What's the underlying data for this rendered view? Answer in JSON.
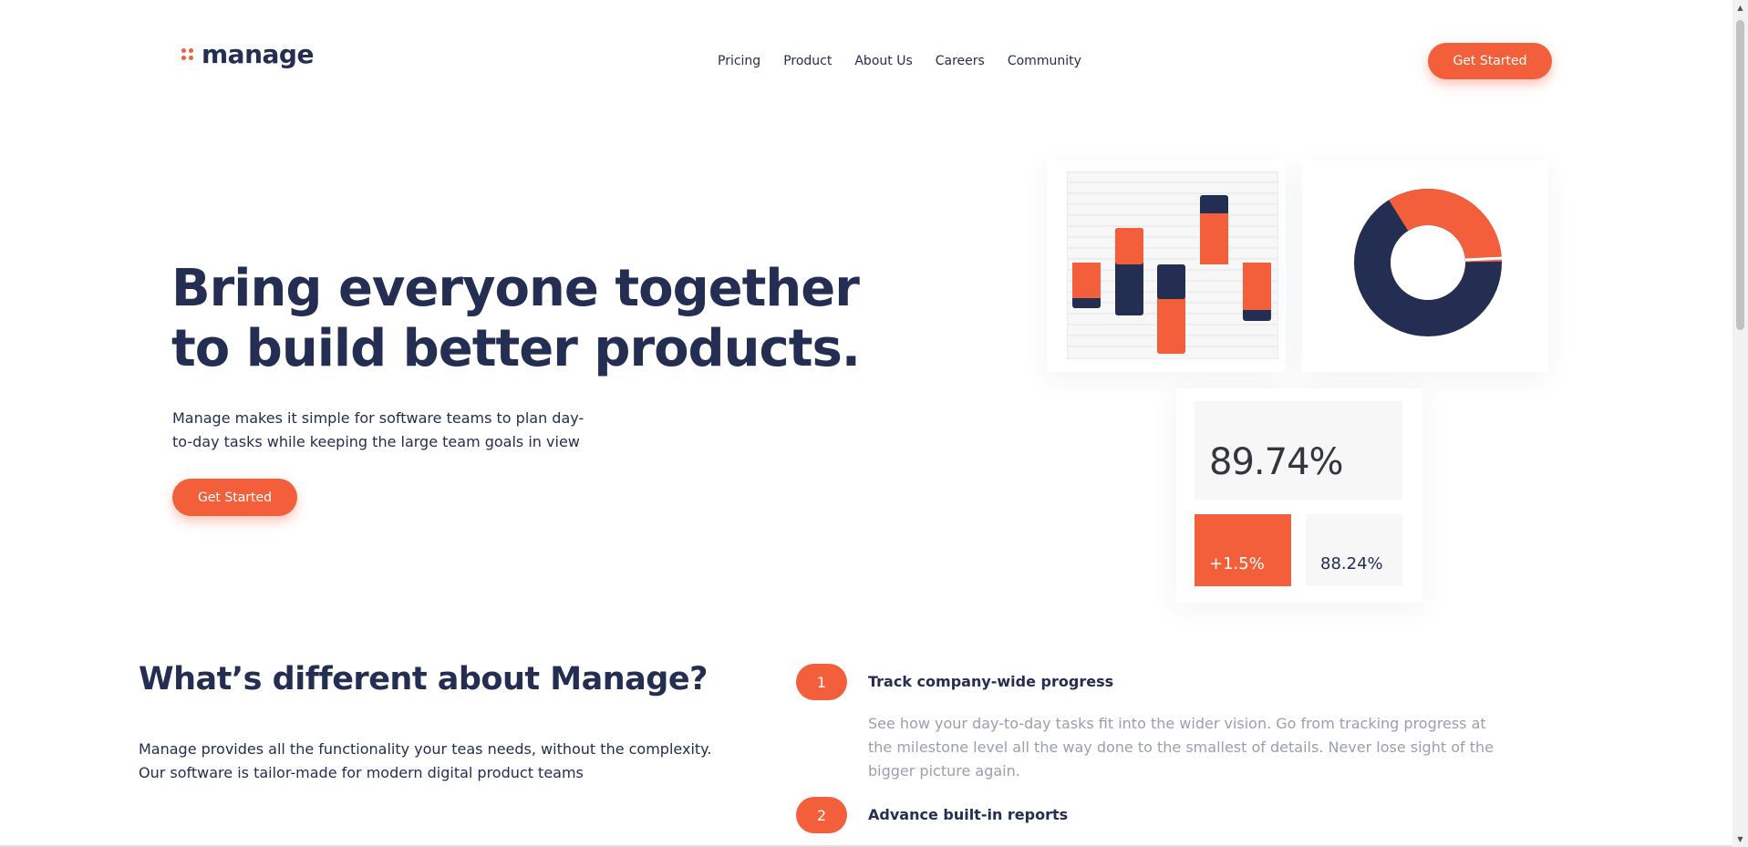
{
  "brand": {
    "name": "manage",
    "accent_color": "#f25f3a",
    "dark_color": "#242d52"
  },
  "nav": {
    "items": [
      {
        "label": "Pricing"
      },
      {
        "label": "Product"
      },
      {
        "label": "About Us"
      },
      {
        "label": "Careers"
      },
      {
        "label": "Community"
      }
    ]
  },
  "header": {
    "cta_label": "Get Started"
  },
  "hero": {
    "title": "Bring everyone together to build better products.",
    "description": "Manage makes it simple for software teams to plan day-to-day tasks while keeping the large team goals in view",
    "cta_label": "Get Started"
  },
  "dashboard": {
    "main_stat": "89.74%",
    "change_stat": "+1.5%",
    "secondary_stat": "88.24%"
  },
  "different": {
    "title": "What’s different about Manage?",
    "description": "Manage provides all the functionality your teas needs, without the complexity. Our software is tailor-made for modern digital product teams",
    "features": [
      {
        "number": "1",
        "title": "Track company-wide progress",
        "description": "See how your day-to-day tasks fit into the wider vision. Go from tracking progress at the milestone level all the way done to the smallest of details. Never lose sight of the bigger picture again."
      },
      {
        "number": "2",
        "title": "Advance built-in reports",
        "description": ""
      }
    ]
  }
}
